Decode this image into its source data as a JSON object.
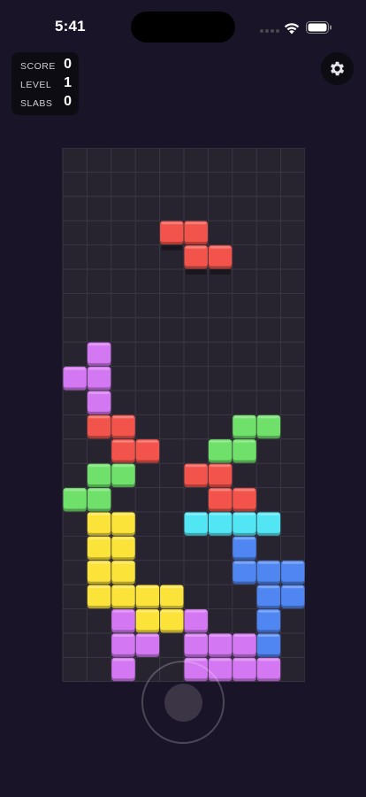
{
  "status_bar": {
    "time": "5:41"
  },
  "stats": [
    {
      "label": "SCORE",
      "value": "0"
    },
    {
      "label": "LEVEL",
      "value": "1"
    },
    {
      "label": "SLABS",
      "value": "0"
    }
  ],
  "settings": {
    "icon": "gear-icon"
  },
  "colors": {
    "background": "#1a1428",
    "purple": "#d477f2",
    "red": "#f2534a",
    "green": "#6fe06a",
    "yellow": "#fbe33a",
    "cyan": "#52e6f4",
    "blue": "#4f86f2"
  },
  "board": {
    "cols": 10,
    "rows": 22,
    "active_piece": {
      "color": "red",
      "cells": [
        [
          4,
          3
        ],
        [
          5,
          3
        ],
        [
          5,
          4
        ],
        [
          6,
          4
        ]
      ]
    },
    "locked_cells": [
      {
        "c": 1,
        "r": 8,
        "color": "purple"
      },
      {
        "c": 0,
        "r": 9,
        "color": "purple"
      },
      {
        "c": 1,
        "r": 9,
        "color": "purple"
      },
      {
        "c": 1,
        "r": 10,
        "color": "purple"
      },
      {
        "c": 1,
        "r": 11,
        "color": "red"
      },
      {
        "c": 2,
        "r": 11,
        "color": "red"
      },
      {
        "c": 2,
        "r": 12,
        "color": "red"
      },
      {
        "c": 3,
        "r": 12,
        "color": "red"
      },
      {
        "c": 7,
        "r": 11,
        "color": "green"
      },
      {
        "c": 8,
        "r": 11,
        "color": "green"
      },
      {
        "c": 6,
        "r": 12,
        "color": "green"
      },
      {
        "c": 7,
        "r": 12,
        "color": "green"
      },
      {
        "c": 1,
        "r": 13,
        "color": "green"
      },
      {
        "c": 2,
        "r": 13,
        "color": "green"
      },
      {
        "c": 0,
        "r": 14,
        "color": "green"
      },
      {
        "c": 1,
        "r": 14,
        "color": "green"
      },
      {
        "c": 5,
        "r": 13,
        "color": "red"
      },
      {
        "c": 6,
        "r": 13,
        "color": "red"
      },
      {
        "c": 6,
        "r": 14,
        "color": "red"
      },
      {
        "c": 7,
        "r": 14,
        "color": "red"
      },
      {
        "c": 5,
        "r": 15,
        "color": "cyan"
      },
      {
        "c": 6,
        "r": 15,
        "color": "cyan"
      },
      {
        "c": 7,
        "r": 15,
        "color": "cyan"
      },
      {
        "c": 8,
        "r": 15,
        "color": "cyan"
      },
      {
        "c": 1,
        "r": 15,
        "color": "yellow"
      },
      {
        "c": 2,
        "r": 15,
        "color": "yellow"
      },
      {
        "c": 1,
        "r": 16,
        "color": "yellow"
      },
      {
        "c": 2,
        "r": 16,
        "color": "yellow"
      },
      {
        "c": 1,
        "r": 17,
        "color": "yellow"
      },
      {
        "c": 2,
        "r": 17,
        "color": "yellow"
      },
      {
        "c": 1,
        "r": 18,
        "color": "yellow"
      },
      {
        "c": 2,
        "r": 18,
        "color": "yellow"
      },
      {
        "c": 3,
        "r": 18,
        "color": "yellow"
      },
      {
        "c": 4,
        "r": 18,
        "color": "yellow"
      },
      {
        "c": 3,
        "r": 19,
        "color": "yellow"
      },
      {
        "c": 4,
        "r": 19,
        "color": "yellow"
      },
      {
        "c": 7,
        "r": 16,
        "color": "blue"
      },
      {
        "c": 7,
        "r": 17,
        "color": "blue"
      },
      {
        "c": 8,
        "r": 17,
        "color": "blue"
      },
      {
        "c": 9,
        "r": 17,
        "color": "blue"
      },
      {
        "c": 8,
        "r": 18,
        "color": "blue"
      },
      {
        "c": 9,
        "r": 18,
        "color": "blue"
      },
      {
        "c": 8,
        "r": 19,
        "color": "blue"
      },
      {
        "c": 8,
        "r": 20,
        "color": "blue"
      },
      {
        "c": 2,
        "r": 19,
        "color": "purple"
      },
      {
        "c": 2,
        "r": 20,
        "color": "purple"
      },
      {
        "c": 3,
        "r": 20,
        "color": "purple"
      },
      {
        "c": 2,
        "r": 21,
        "color": "purple"
      },
      {
        "c": 5,
        "r": 19,
        "color": "purple"
      },
      {
        "c": 5,
        "r": 20,
        "color": "purple"
      },
      {
        "c": 6,
        "r": 20,
        "color": "purple"
      },
      {
        "c": 7,
        "r": 20,
        "color": "purple"
      },
      {
        "c": 5,
        "r": 21,
        "color": "purple"
      },
      {
        "c": 6,
        "r": 21,
        "color": "purple"
      },
      {
        "c": 7,
        "r": 21,
        "color": "purple"
      },
      {
        "c": 8,
        "r": 21,
        "color": "purple"
      }
    ]
  },
  "joystick": {
    "icon": "joystick"
  }
}
